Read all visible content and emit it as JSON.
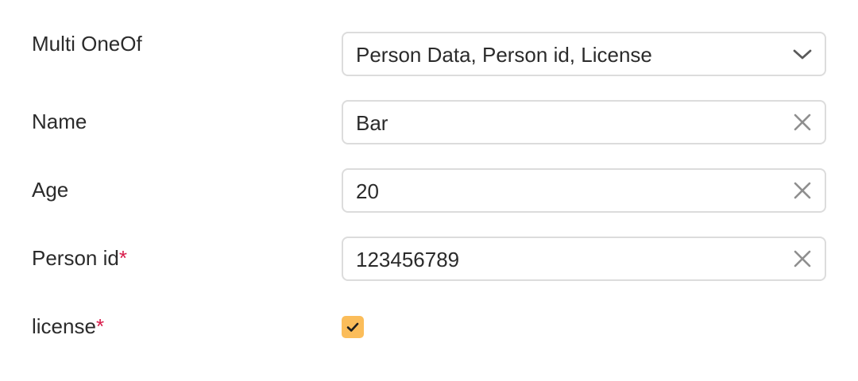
{
  "form": {
    "multi_oneof": {
      "label": "Multi OneOf",
      "value": "Person Data, Person id, License",
      "icon": "chevron-down-icon"
    },
    "name": {
      "label": "Name",
      "value": "Bar",
      "icon": "clear-icon"
    },
    "age": {
      "label": "Age",
      "value": "20",
      "icon": "clear-icon"
    },
    "person_id": {
      "label": "Person id",
      "required_mark": "*",
      "value": "123456789",
      "icon": "clear-icon"
    },
    "license": {
      "label": "license",
      "required_mark": "*",
      "checked": true,
      "icon": "check-icon"
    }
  },
  "colors": {
    "text": "#2b2b2b",
    "required": "#d81b4a",
    "border": "#dcdcdc",
    "icon": "#8f8f8f",
    "checkbox_fill": "#fbbd5a"
  }
}
